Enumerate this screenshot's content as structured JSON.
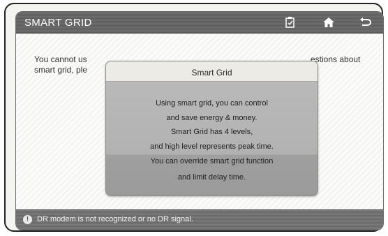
{
  "header": {
    "title": "SMART GRID"
  },
  "icons": {
    "clipboard": "clipboard-icon",
    "home": "home-icon",
    "back": "back-icon",
    "info": "info-icon"
  },
  "background_text": {
    "line1_left": "You cannot us",
    "line1_right": "estions about",
    "line2": "smart grid, ple"
  },
  "dialog": {
    "title": "Smart Grid",
    "lines": [
      "Using smart grid, you can control",
      "and save energy & money.",
      "Smart Grid has 4 levels,",
      "and high level represents peak time.",
      "You can override smart grid function",
      "and limit delay time."
    ]
  },
  "footer": {
    "status": "DR modem is not recognized or no DR signal."
  },
  "colors": {
    "titlebar": "#666666",
    "dialog_header": "#ecebe6",
    "dialog_body": "#b6b6b6"
  }
}
